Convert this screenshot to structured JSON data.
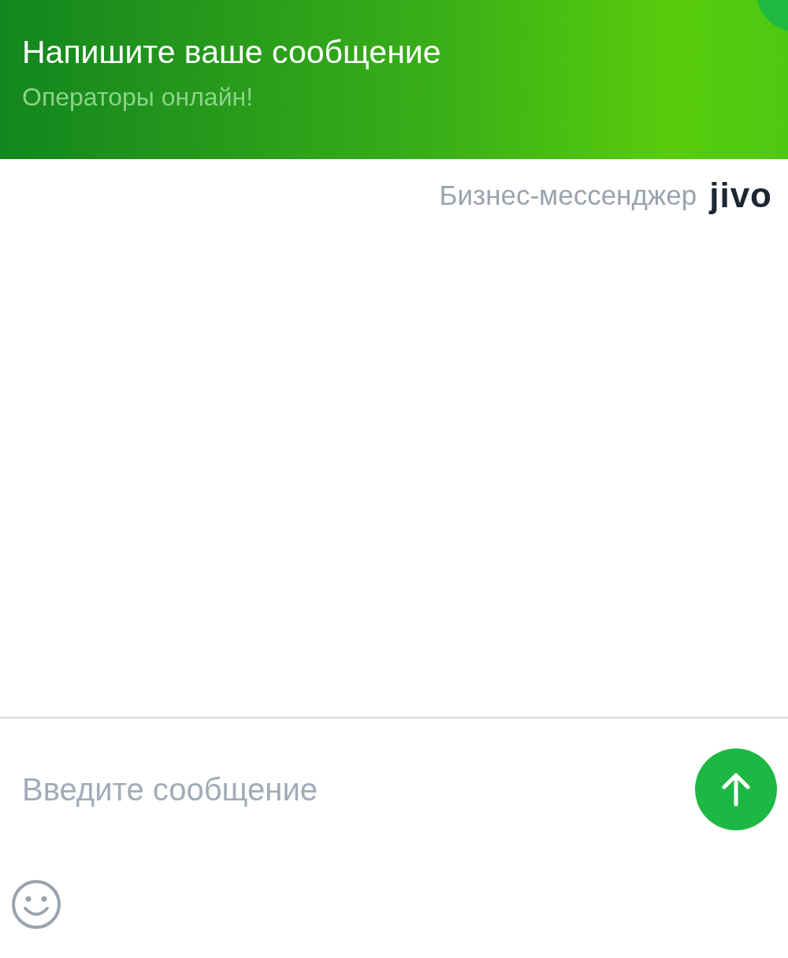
{
  "header": {
    "title": "Напишите ваше сообщение",
    "subtitle": "Операторы онлайн!"
  },
  "branding": {
    "label": "Бизнес-мессенджер",
    "logo": "jivo"
  },
  "composer": {
    "placeholder": "Введите сообщение"
  }
}
